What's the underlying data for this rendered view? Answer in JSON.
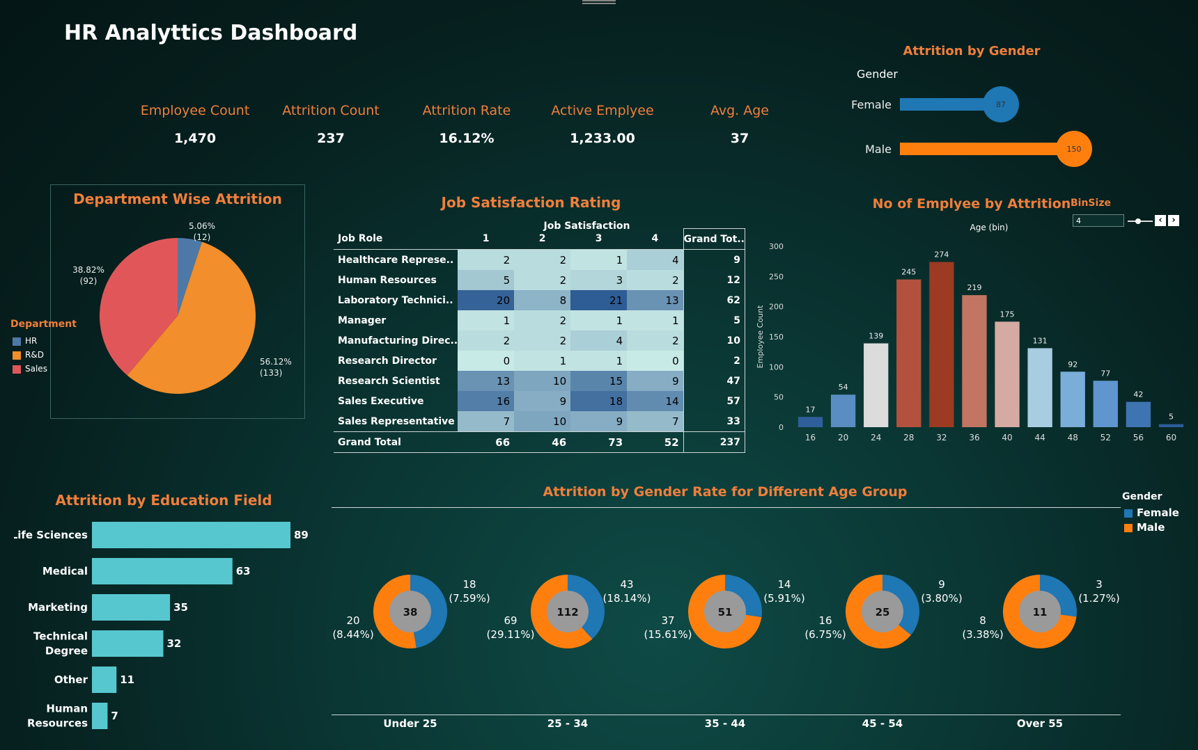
{
  "dashboard": {
    "title": "HR Analyttics Dashboard"
  },
  "kpis": [
    {
      "label": "Employee Count",
      "value": "1,470"
    },
    {
      "label": "Attrition Count",
      "value": "237"
    },
    {
      "label": "Attrition Rate",
      "value": "16.12%"
    },
    {
      "label": "Active Emplyee",
      "value": "1,233.00"
    },
    {
      "label": "Avg. Age",
      "value": "37"
    }
  ],
  "gender_attrition": {
    "title": "Attrition by Gender",
    "axis_label": "Gender",
    "rows": [
      {
        "label": "Female",
        "value": 87,
        "color": "#1f77b4"
      },
      {
        "label": "Male",
        "value": 150,
        "color": "#ff7f0e"
      }
    ]
  },
  "department": {
    "title": "Department Wise Attrition",
    "legend_title": "Department",
    "slices": [
      {
        "name": "HR",
        "value": 12,
        "pct": "5.06%",
        "label": "(12)",
        "color": "#4e79a7"
      },
      {
        "name": "R&D",
        "value": 133,
        "pct": "56.12%",
        "label": "(133)",
        "color": "#f28e2b"
      },
      {
        "name": "Sales",
        "value": 92,
        "pct": "38.82%",
        "label": "(92)",
        "color": "#e15759"
      }
    ]
  },
  "job_satisfaction": {
    "title": "Job Satisfaction Rating",
    "column_group": "Job Satisfaction",
    "row_header": "Job Role",
    "columns": [
      "1",
      "2",
      "3",
      "4"
    ],
    "grand_total_header": "Grand Tot..",
    "rows": [
      {
        "role": "Healthcare Represe..",
        "values": [
          2,
          2,
          1,
          4
        ],
        "total": 9
      },
      {
        "role": "Human Resources",
        "values": [
          5,
          2,
          3,
          2
        ],
        "total": 12
      },
      {
        "role": "Laboratory Technici..",
        "values": [
          20,
          8,
          21,
          13
        ],
        "total": 62
      },
      {
        "role": "Manager",
        "values": [
          1,
          2,
          1,
          1
        ],
        "total": 5
      },
      {
        "role": "Manufacturing Direc..",
        "values": [
          2,
          2,
          4,
          2
        ],
        "total": 10
      },
      {
        "role": "Research Director",
        "values": [
          0,
          1,
          1,
          0
        ],
        "total": 2
      },
      {
        "role": "Research Scientist",
        "values": [
          13,
          10,
          15,
          9
        ],
        "total": 47
      },
      {
        "role": "Sales Executive",
        "values": [
          16,
          9,
          18,
          14
        ],
        "total": 57
      },
      {
        "role": "Sales Representative",
        "values": [
          7,
          10,
          9,
          7
        ],
        "total": 33
      }
    ],
    "grand_total": {
      "label": "Grand Total",
      "values": [
        66,
        46,
        73,
        52
      ],
      "total": 237
    }
  },
  "age_hist": {
    "title": "No of Emplyee by Attrition",
    "binsize_label": "BinSize",
    "binsize_value": "4",
    "x_title": "Age (bin)",
    "y_title": "Employee Count",
    "y_ticks": [
      "0",
      "50",
      "100",
      "150",
      "200",
      "250",
      "300"
    ]
  },
  "education": {
    "title": "Attrition by Education Field",
    "rows": [
      {
        "label": [
          "Life Sciences"
        ],
        "value": 89
      },
      {
        "label": [
          "Medical"
        ],
        "value": 63
      },
      {
        "label": [
          "Marketing"
        ],
        "value": 35
      },
      {
        "label": [
          "Technical",
          "Degree"
        ],
        "value": 32
      },
      {
        "label": [
          "Other"
        ],
        "value": 11
      },
      {
        "label": [
          "Human",
          "Resources"
        ],
        "value": 7
      }
    ]
  },
  "age_group": {
    "title": "Attrition by Gender Rate for Different Age Group",
    "legend_title": "Gender",
    "legend": [
      {
        "name": "Female",
        "color": "#1f77b4"
      },
      {
        "name": "Male",
        "color": "#ff7f0e"
      }
    ],
    "groups": [
      {
        "name": "Under 25",
        "total": "38",
        "female": 18,
        "female_pct": "(7.59%)",
        "male": 20,
        "male_pct": "(8.44%)"
      },
      {
        "name": "25 - 34",
        "total": "112",
        "female": 43,
        "female_pct": "(18.14%)",
        "male": 69,
        "male_pct": "(29.11%)"
      },
      {
        "name": "35 - 44",
        "total": "51",
        "female": 14,
        "female_pct": "(5.91%)",
        "male": 37,
        "male_pct": "(15.61%)"
      },
      {
        "name": "45 - 54",
        "total": "25",
        "female": 9,
        "female_pct": "(3.80%)",
        "male": 16,
        "male_pct": "(6.75%)"
      },
      {
        "name": "Over 55",
        "total": "11",
        "female": 3,
        "female_pct": "(1.27%)",
        "male": 8,
        "male_pct": "(3.38%)"
      }
    ]
  },
  "chart_data": [
    {
      "type": "bar",
      "title": "Attrition by Gender",
      "categories": [
        "Female",
        "Male"
      ],
      "values": [
        87,
        150
      ]
    },
    {
      "type": "pie",
      "title": "Department Wise Attrition",
      "categories": [
        "HR",
        "R&D",
        "Sales"
      ],
      "values": [
        12,
        133,
        92
      ]
    },
    {
      "type": "heatmap",
      "title": "Job Satisfaction Rating",
      "x": [
        "1",
        "2",
        "3",
        "4"
      ],
      "y": [
        "Healthcare Represe..",
        "Human Resources",
        "Laboratory Technici..",
        "Manager",
        "Manufacturing Direc..",
        "Research Director",
        "Research Scientist",
        "Sales Executive",
        "Sales Representative"
      ],
      "values": [
        [
          2,
          2,
          1,
          4
        ],
        [
          5,
          2,
          3,
          2
        ],
        [
          20,
          8,
          21,
          13
        ],
        [
          1,
          2,
          1,
          1
        ],
        [
          2,
          2,
          4,
          2
        ],
        [
          0,
          1,
          1,
          0
        ],
        [
          13,
          10,
          15,
          9
        ],
        [
          16,
          9,
          18,
          14
        ],
        [
          7,
          10,
          9,
          7
        ]
      ]
    },
    {
      "type": "bar",
      "title": "No of Emplyee by Attrition",
      "xlabel": "Age (bin)",
      "ylabel": "Employee Count",
      "categories": [
        "16",
        "20",
        "24",
        "28",
        "32",
        "36",
        "40",
        "44",
        "48",
        "52",
        "56",
        "60"
      ],
      "values": [
        17,
        54,
        139,
        245,
        274,
        219,
        175,
        131,
        92,
        77,
        42,
        5
      ],
      "colors": [
        "#2f5f9a",
        "#5a8dc2",
        "#dcdcdc",
        "#b2523e",
        "#9c3a22",
        "#c27563",
        "#d4aaa2",
        "#a9cde0",
        "#7aaed9",
        "#5f96d0",
        "#3f74b3",
        "#2c5c9a"
      ],
      "ylim": [
        0,
        300
      ]
    },
    {
      "type": "bar",
      "title": "Attrition by Education Field",
      "categories": [
        "Life Sciences",
        "Medical",
        "Marketing",
        "Technical Degree",
        "Other",
        "Human Resources"
      ],
      "values": [
        89,
        63,
        35,
        32,
        11,
        7
      ]
    },
    {
      "type": "pie",
      "title": "Attrition by Gender Rate for Different Age Group",
      "categories": [
        "Under 25",
        "25 - 34",
        "35 - 44",
        "45 - 54",
        "Over 55"
      ],
      "series": [
        {
          "name": "Female",
          "values": [
            18,
            43,
            14,
            9,
            3
          ]
        },
        {
          "name": "Male",
          "values": [
            20,
            69,
            37,
            16,
            8
          ]
        }
      ]
    }
  ]
}
